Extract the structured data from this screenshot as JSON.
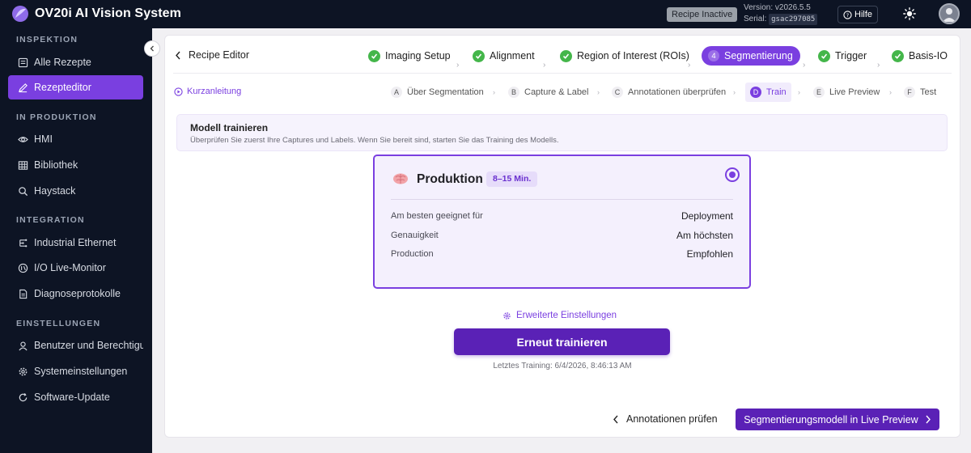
{
  "app": {
    "title": "OV20i AI Vision System"
  },
  "topbar": {
    "status": "Recipe Inactive",
    "version": "Version: v2026.5.5",
    "serial_label": "Serial:",
    "serial_value": "gsac297085",
    "help_label": "Hilfe"
  },
  "sidebar": {
    "sections": [
      {
        "label": "INSPEKTION",
        "items": [
          {
            "label": "Alle Rezepte",
            "icon": "list-icon"
          },
          {
            "label": "Rezepteditor",
            "icon": "edit-icon",
            "active": true
          }
        ]
      },
      {
        "label": "IN PRODUKTION",
        "items": [
          {
            "label": "HMI",
            "icon": "eye-icon"
          },
          {
            "label": "Bibliothek",
            "icon": "grid-icon"
          },
          {
            "label": "Haystack",
            "icon": "search-icon"
          }
        ]
      },
      {
        "label": "INTEGRATION",
        "items": [
          {
            "label": "Industrial Ethernet",
            "icon": "network-icon"
          },
          {
            "label": "I/O Live-Monitor",
            "icon": "io-icon"
          },
          {
            "label": "Diagnoseprotokolle",
            "icon": "log-icon"
          }
        ]
      },
      {
        "label": "EINSTELLUNGEN",
        "items": [
          {
            "label": "Benutzer und Berechtigungen",
            "icon": "user-icon"
          },
          {
            "label": "Systemeinstellungen",
            "icon": "gear-icon"
          },
          {
            "label": "Software-Update",
            "icon": "refresh-icon"
          }
        ]
      }
    ]
  },
  "editor": {
    "back_label": "Recipe Editor",
    "steps": [
      {
        "label": "Imaging Setup",
        "state": "done"
      },
      {
        "label": "Alignment",
        "state": "done"
      },
      {
        "label": "Region of Interest (ROIs)",
        "state": "done"
      },
      {
        "label": "Segmentierung",
        "state": "active",
        "num": "4"
      },
      {
        "label": "Trigger",
        "state": "done"
      },
      {
        "label": "Basis-IO",
        "state": "done"
      }
    ],
    "guide_label": "Kurzanleitung",
    "substeps": [
      {
        "letter": "A",
        "label": "Über Segmentation"
      },
      {
        "letter": "B",
        "label": "Capture & Label"
      },
      {
        "letter": "C",
        "label": "Annotationen überprüfen"
      },
      {
        "letter": "D",
        "label": "Train",
        "active": true
      },
      {
        "letter": "E",
        "label": "Live Preview"
      },
      {
        "letter": "F",
        "label": "Test"
      }
    ]
  },
  "banner": {
    "title": "Modell trainieren",
    "desc": "Überprüfen Sie zuerst Ihre Captures und Labels. Wenn Sie bereit sind, starten Sie das Training des Modells."
  },
  "model": {
    "name": "Produktion",
    "time": "8–15 Min.",
    "selected": true,
    "rows": [
      {
        "label": "Am besten geeignet für",
        "value": "Deployment"
      },
      {
        "label": "Genauigkeit",
        "value": "Am höchsten"
      },
      {
        "label": "Production",
        "value": "Empfohlen"
      }
    ]
  },
  "actions": {
    "advanced": "Erweiterte Einstellungen",
    "retrain": "Erneut trainieren",
    "last_training": "Letztes Training: 6/4/2026, 8:46:13 AM",
    "back": "Annotationen prüfen",
    "next": "Segmentierungsmodell in Live Preview"
  },
  "colors": {
    "accent": "#7a3fe0",
    "accent_dark": "#5a21b6",
    "success": "#44b64a",
    "sidebar_bg": "#0d1424"
  }
}
